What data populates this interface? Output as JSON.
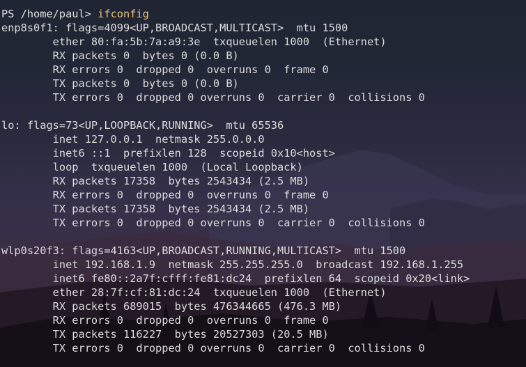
{
  "terminal": {
    "prompt": "PS /home/paul> ",
    "command": "ifconfig",
    "output": [
      "enp8s0f1: flags=4099<UP,BROADCAST,MULTICAST>  mtu 1500",
      "        ether 80:fa:5b:7a:a9:3e  txqueuelen 1000  (Ethernet)",
      "        RX packets 0  bytes 0 (0.0 B)",
      "        RX errors 0  dropped 0  overruns 0  frame 0",
      "        TX packets 0  bytes 0 (0.0 B)",
      "        TX errors 0  dropped 0 overruns 0  carrier 0  collisions 0",
      "",
      "lo: flags=73<UP,LOOPBACK,RUNNING>  mtu 65536",
      "        inet 127.0.0.1  netmask 255.0.0.0",
      "        inet6 ::1  prefixlen 128  scopeid 0x10<host>",
      "        loop  txqueuelen 1000  (Local Loopback)",
      "        RX packets 17358  bytes 2543434 (2.5 MB)",
      "        RX errors 0  dropped 0  overruns 0  frame 0",
      "        TX packets 17358  bytes 2543434 (2.5 MB)",
      "        TX errors 0  dropped 0 overruns 0  carrier 0  collisions 0",
      "",
      "wlp0s20f3: flags=4163<UP,BROADCAST,RUNNING,MULTICAST>  mtu 1500",
      "        inet 192.168.1.9  netmask 255.255.255.0  broadcast 192.168.1.255",
      "        inet6 fe80::2a7f:cfff:fe81:dc24  prefixlen 64  scopeid 0x20<link>",
      "        ether 28:7f:cf:81:dc:24  txqueuelen 1000  (Ethernet)",
      "        RX packets 689015  bytes 476344665 (476.3 MB)",
      "        RX errors 0  dropped 0  overruns 0  frame 0",
      "        TX packets 116227  bytes 20527303 (20.5 MB)",
      "        TX errors 0  dropped 0 overruns 0  carrier 0  collisions 0"
    ]
  },
  "colors": {
    "text": "#dcdcdc",
    "command": "#e6c07b"
  }
}
